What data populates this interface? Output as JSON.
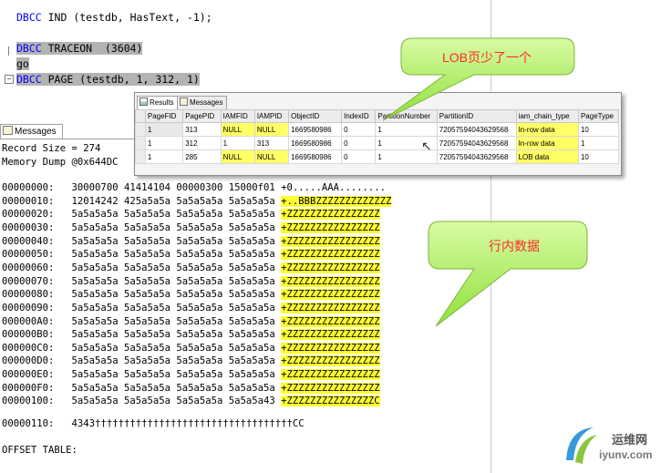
{
  "editor": {
    "line1_prefix": "DBCC",
    "line1_rest": " IND (testdb, HasText, -1);",
    "line2_prefix": "DBCC",
    "line2_rest": " TRACEON  (3604)",
    "line3": "go",
    "line4_prefix": "DBCC",
    "line4_rest": " PAGE (testdb, 1, 312, 1)"
  },
  "messages": {
    "tab_label": "Messages",
    "record_size": "Record Size = 274",
    "memory_dump": "Memory Dump @0x644DC",
    "dump_rows": [
      {
        "off": "00000000:",
        "hex": "30000700 41414104 00000300 15000f01",
        "asc": "+0.....AAA........"
      },
      {
        "off": "00000010:",
        "hex": "12014242 425a5a5a 5a5a5a5a 5a5a5a5a",
        "asc": "+..BBBZZZZZZZZZZZZZ"
      },
      {
        "off": "00000020:",
        "hex": "5a5a5a5a 5a5a5a5a 5a5a5a5a 5a5a5a5a",
        "asc": "+ZZZZZZZZZZZZZZZZ"
      },
      {
        "off": "00000030:",
        "hex": "5a5a5a5a 5a5a5a5a 5a5a5a5a 5a5a5a5a",
        "asc": "+ZZZZZZZZZZZZZZZZ"
      },
      {
        "off": "00000040:",
        "hex": "5a5a5a5a 5a5a5a5a 5a5a5a5a 5a5a5a5a",
        "asc": "+ZZZZZZZZZZZZZZZZ"
      },
      {
        "off": "00000050:",
        "hex": "5a5a5a5a 5a5a5a5a 5a5a5a5a 5a5a5a5a",
        "asc": "+ZZZZZZZZZZZZZZZZ"
      },
      {
        "off": "00000060:",
        "hex": "5a5a5a5a 5a5a5a5a 5a5a5a5a 5a5a5a5a",
        "asc": "+ZZZZZZZZZZZZZZZZ"
      },
      {
        "off": "00000070:",
        "hex": "5a5a5a5a 5a5a5a5a 5a5a5a5a 5a5a5a5a",
        "asc": "+ZZZZZZZZZZZZZZZZ"
      },
      {
        "off": "00000080:",
        "hex": "5a5a5a5a 5a5a5a5a 5a5a5a5a 5a5a5a5a",
        "asc": "+ZZZZZZZZZZZZZZZZ"
      },
      {
        "off": "00000090:",
        "hex": "5a5a5a5a 5a5a5a5a 5a5a5a5a 5a5a5a5a",
        "asc": "+ZZZZZZZZZZZZZZZZ"
      },
      {
        "off": "000000A0:",
        "hex": "5a5a5a5a 5a5a5a5a 5a5a5a5a 5a5a5a5a",
        "asc": "+ZZZZZZZZZZZZZZZZ"
      },
      {
        "off": "000000B0:",
        "hex": "5a5a5a5a 5a5a5a5a 5a5a5a5a 5a5a5a5a",
        "asc": "+ZZZZZZZZZZZZZZZZ"
      },
      {
        "off": "000000C0:",
        "hex": "5a5a5a5a 5a5a5a5a 5a5a5a5a 5a5a5a5a",
        "asc": "+ZZZZZZZZZZZZZZZZ"
      },
      {
        "off": "000000D0:",
        "hex": "5a5a5a5a 5a5a5a5a 5a5a5a5a 5a5a5a5a",
        "asc": "+ZZZZZZZZZZZZZZZZ"
      },
      {
        "off": "000000E0:",
        "hex": "5a5a5a5a 5a5a5a5a 5a5a5a5a 5a5a5a5a",
        "asc": "+ZZZZZZZZZZZZZZZZ"
      },
      {
        "off": "000000F0:",
        "hex": "5a5a5a5a 5a5a5a5a 5a5a5a5a 5a5a5a5a",
        "asc": "+ZZZZZZZZZZZZZZZZ"
      },
      {
        "off": "00000100:",
        "hex": "5a5a5a5a 5a5a5a5a 5a5a5a5a 5a5a5a43",
        "asc": "+ZZZZZZZZZZZZZZZC"
      }
    ],
    "last_row_off": "00000110:",
    "last_row_rest": "4343††††††††††††††††††††††††††††††††††CC",
    "offset_table": "OFFSET TABLE:"
  },
  "results": {
    "tab_results": "Results",
    "tab_messages": "Messages",
    "columns": [
      "PageFID",
      "PagePID",
      "IAMFID",
      "IAMPID",
      "ObjectID",
      "IndexID",
      "PartitionNumber",
      "PartitionID",
      "iam_chain_type",
      "PageType"
    ],
    "rows": [
      [
        "1",
        "313",
        "NULL",
        "NULL",
        "1669580986",
        "0",
        "1",
        "72057594043629568",
        "In-row data",
        "10"
      ],
      [
        "1",
        "312",
        "1",
        "313",
        "1669580986",
        "0",
        "1",
        "72057594043629568",
        "In-row data",
        "1"
      ],
      [
        "1",
        "285",
        "NULL",
        "NULL",
        "1669580986",
        "0",
        "1",
        "72057594043629568",
        "LOB data",
        "10"
      ]
    ]
  },
  "callouts": {
    "lob": "LOB页少了一个",
    "inrow": "行内数据"
  },
  "watermark": {
    "cn": "运维网",
    "url": "iyunv.com"
  },
  "colors": {
    "highlight": "#ffff33",
    "callout_fill": "#b8f26a",
    "callout_text": "#ff2a2a",
    "keyword": "#0000ff"
  }
}
